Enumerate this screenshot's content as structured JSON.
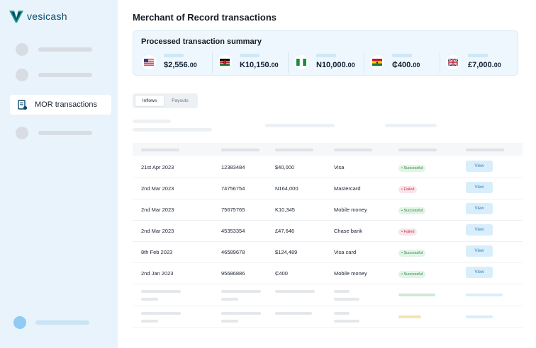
{
  "brand": {
    "name": "vesicash"
  },
  "sidebar": {
    "active_item": "MOR transactions"
  },
  "page": {
    "title": "Merchant of Record transactions"
  },
  "summary": {
    "title": "Processed transaction summary",
    "currencies": [
      {
        "flag": "us-flag-icon",
        "whole": "$2,556.",
        "cents": "00"
      },
      {
        "flag": "kenya-flag-icon",
        "whole": "K10,150.",
        "cents": "00"
      },
      {
        "flag": "nigeria-flag-icon",
        "whole": "N10,000.",
        "cents": "00"
      },
      {
        "flag": "ghana-flag-icon",
        "whole": "₵400.",
        "cents": "00"
      },
      {
        "flag": "uk-flag-icon",
        "whole": "£7,000.",
        "cents": "00"
      }
    ]
  },
  "tabs": [
    {
      "label": "Inflows",
      "active": true
    },
    {
      "label": "Payouts",
      "active": false
    }
  ],
  "table": {
    "view_label": "View",
    "rows": [
      {
        "date": "21st Apr 2023",
        "id": "12383484",
        "amount": "$40,000",
        "method": "Visa",
        "status": "• Successful",
        "state": "success"
      },
      {
        "date": "2nd Mar 2023",
        "id": "74756754",
        "amount": "N164,000",
        "method": "Mastercard",
        "status": "• Failed",
        "state": "failed"
      },
      {
        "date": "2nd Mar 2023",
        "id": "75675765",
        "amount": "K10,345",
        "method": "Mobile money",
        "status": "• Successful",
        "state": "success"
      },
      {
        "date": "2nd Mar 2023",
        "id": "45353354",
        "amount": "£47,646",
        "method": "Chase bank",
        "status": "• Failed",
        "state": "failed"
      },
      {
        "date": "8th Feb 2023",
        "id": "46589678",
        "amount": "$124,489",
        "method": "Visa card",
        "status": "• Successful",
        "state": "success"
      },
      {
        "date": "2nd Jan 2023",
        "id": "95686886",
        "amount": "₵400",
        "method": "Mobile money",
        "status": "• Successful",
        "state": "success"
      }
    ]
  },
  "colors": {
    "accent": "#0b4a6b",
    "success": "#2a8a44",
    "failed": "#c43a52",
    "sidebar": "#e9f3fb"
  }
}
